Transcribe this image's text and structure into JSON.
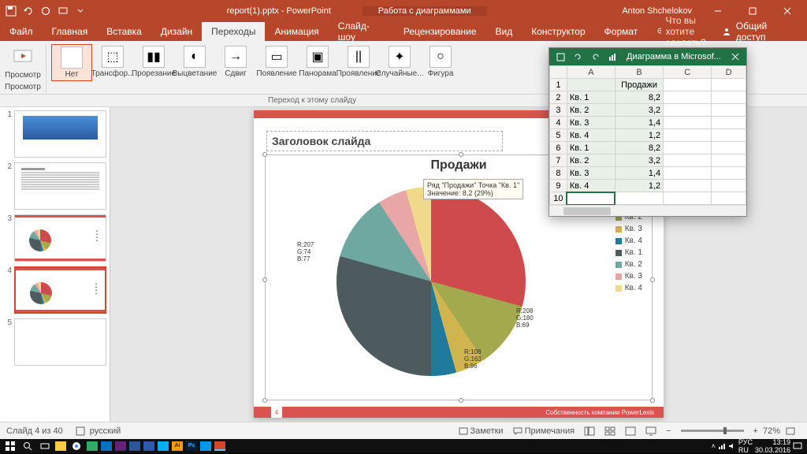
{
  "titlebar": {
    "filename": "report(1).pptx - PowerPoint",
    "chart_tools": "Работа с диаграммами",
    "username": "Anton Shchelokov"
  },
  "ribbon": {
    "tabs": [
      "Файл",
      "Главная",
      "Вставка",
      "Дизайн",
      "Переходы",
      "Анимация",
      "Слайд-шоу",
      "Рецензирование",
      "Вид",
      "Конструктор",
      "Формат"
    ],
    "active_tab_index": 4,
    "tell_me": "Что вы хотите сделать?",
    "share": "Общий доступ",
    "preview_label": "Просмотр",
    "transitions": [
      "Нет",
      "Трансфор...",
      "Прорезание",
      "Выцветание",
      "Сдвиг",
      "Появление",
      "Панорама",
      "Проявление",
      "Случайные...",
      "Фигура"
    ],
    "transition_bar_label": "Переход к этому слайду"
  },
  "slide": {
    "title_placeholder": "Заголовок слайда",
    "footer": "Собственность компании PowerLexis"
  },
  "chart_data": {
    "type": "pie",
    "title": "Продажи",
    "series_name": "Продажи",
    "categories": [
      "Кв. 1",
      "Кв. 2",
      "Кв. 3",
      "Кв. 4",
      "Кв. 1",
      "Кв. 2",
      "Кв. 3",
      "Кв. 4"
    ],
    "values": [
      8.2,
      3.2,
      1.4,
      1.2,
      8.2,
      3.2,
      1.4,
      1.2
    ],
    "colors": [
      "#cf4a4d",
      "#a3a94d",
      "#d0b44d",
      "#1f7a9c",
      "#4d5a5e",
      "#6fa8a0",
      "#e8a6a6",
      "#f0d98a"
    ],
    "tooltip_line1": "Ряд \"Продажи\" Точка \"Кв. 1\"",
    "tooltip_line2": "Значение: 8,2 (29%)",
    "rgb_labels": [
      {
        "r": 207,
        "g": 74,
        "b": 77
      },
      {
        "r": 208,
        "g": 180,
        "b": 69
      },
      {
        "r": 108,
        "g": 163,
        "b": 96
      }
    ]
  },
  "excel": {
    "title": "Диаграмма в Microsof...",
    "header_b": "Продажи",
    "rows": [
      {
        "a": "Кв. 1",
        "b": "8,2"
      },
      {
        "a": "Кв. 2",
        "b": "3,2"
      },
      {
        "a": "Кв. 3",
        "b": "1,4"
      },
      {
        "a": "Кв. 4",
        "b": "1,2"
      },
      {
        "a": "Кв. 1",
        "b": "8,2"
      },
      {
        "a": "Кв. 2",
        "b": "3,2"
      },
      {
        "a": "Кв. 3",
        "b": "1,4"
      },
      {
        "a": "Кв. 4",
        "b": "1,2"
      }
    ]
  },
  "statusbar": {
    "slide_counter": "Слайд 4 из 40",
    "language": "русский",
    "notes": "Заметки",
    "comments": "Примечания",
    "zoom": "72%"
  },
  "taskbar": {
    "lang1": "РУС",
    "lang2": "RU",
    "time": "13:19",
    "date": "30.03.2016"
  }
}
